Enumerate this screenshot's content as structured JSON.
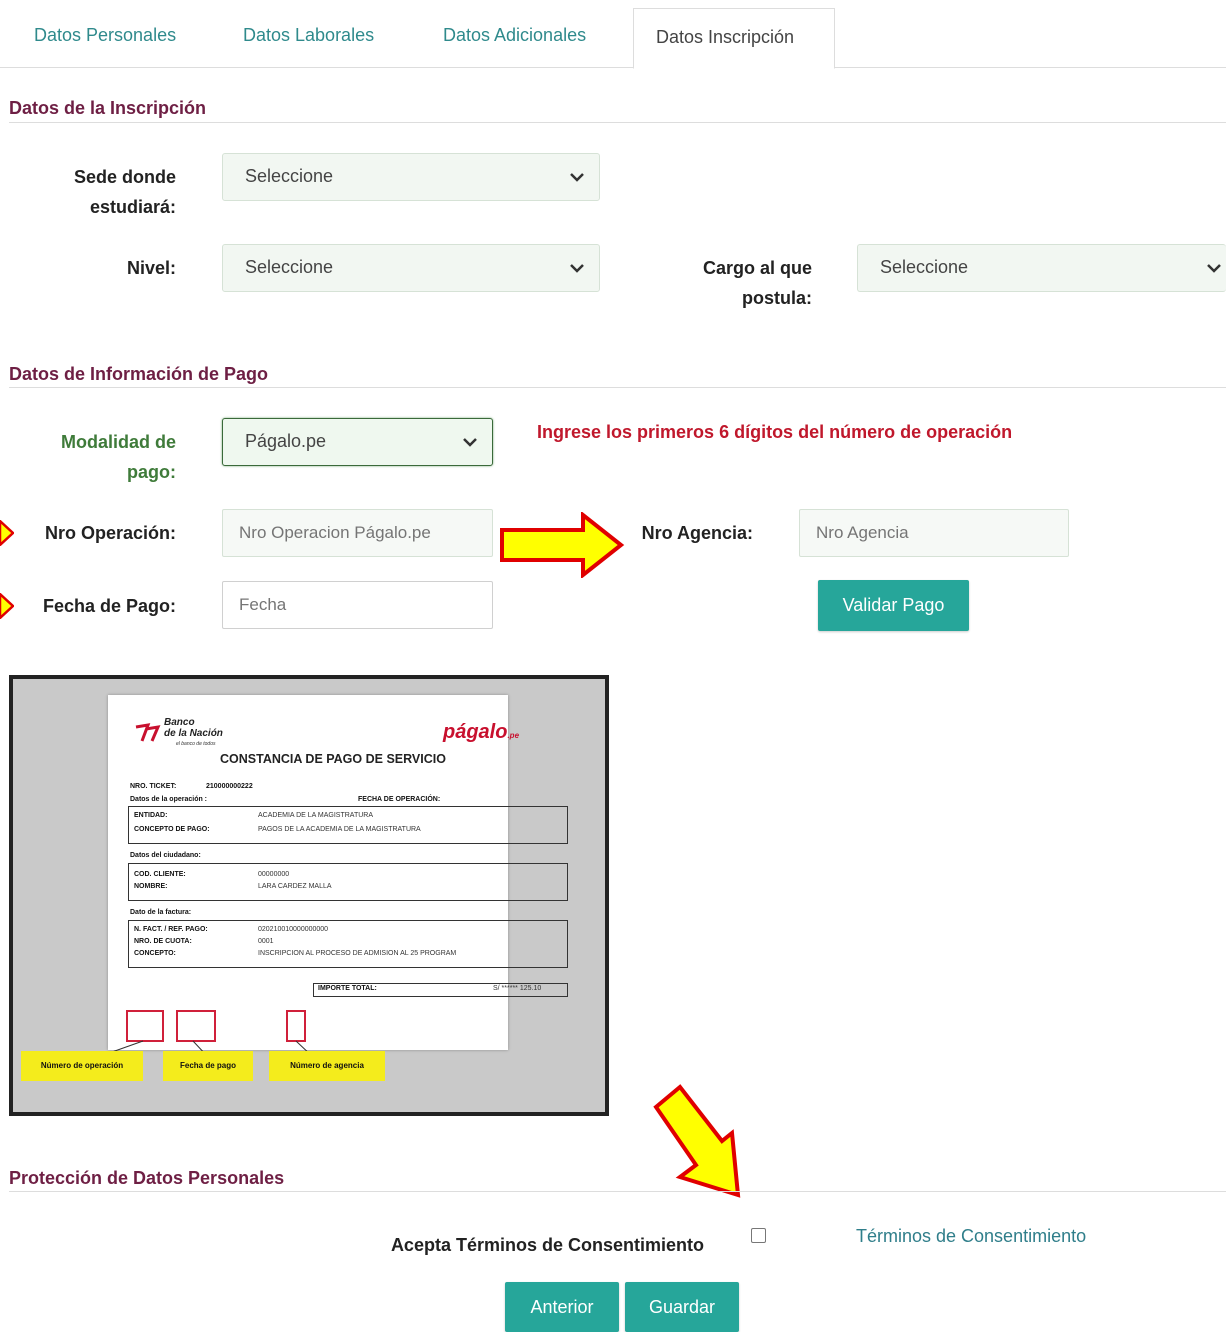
{
  "tabs": [
    {
      "label": "Datos Personales"
    },
    {
      "label": "Datos Laborales"
    },
    {
      "label": "Datos Adicionales"
    },
    {
      "label": "Datos Inscripción",
      "active": true
    }
  ],
  "inscripcion": {
    "title": "Datos de la Inscripción",
    "sede_label": "Sede donde estudiará:",
    "sede_value": "Seleccione",
    "nivel_label": "Nivel:",
    "nivel_value": "Seleccione",
    "cargo_label": "Cargo al que postula:",
    "cargo_value": "Seleccione"
  },
  "pago": {
    "title": "Datos de Información de Pago",
    "modalidad_label": "Modalidad de pago:",
    "modalidad_value": "Págalo.pe",
    "warning": "Ingrese los primeros 6 dígitos del número de operación",
    "operacion_label": "Nro Operación:",
    "operacion_placeholder": "Nro Operacion Págalo.pe",
    "agencia_label": "Nro Agencia:",
    "agencia_placeholder": "Nro Agencia",
    "fecha_label": "Fecha de Pago:",
    "fecha_placeholder": "Fecha",
    "validar_label": "Validar Pago"
  },
  "receipt": {
    "bank_line1": "Banco",
    "bank_line2": "de la Nación",
    "bank_tagline": "el banco de todos",
    "brand": "págalo",
    "brand_suffix": ".pe",
    "title": "CONSTANCIA DE PAGO DE SERVICIO",
    "ticket_label": "NRO. TICKET:",
    "ticket_value": "210000000222",
    "operacion_section": "Datos de la operación :",
    "fecha_op_label": "FECHA DE OPERACIÓN:",
    "entidad_label": "ENTIDAD:",
    "entidad_value": "ACADEMIA DE LA MAGISTRATURA",
    "concepto_label": "CONCEPTO DE PAGO:",
    "concepto_value": "PAGOS DE LA ACADEMIA DE LA MAGISTRATURA",
    "ciudadano_section": "Datos del ciudadano:",
    "cliente_label": "COD. CLIENTE:",
    "cliente_value": "00000000",
    "nombre_label": "NOMBRE:",
    "nombre_value": "LARA CARDEZ MALLA",
    "factura_section": "Dato de la factura:",
    "fact_label": "N. FACT. / REF. PAGO:",
    "fact_value": "020210010000000000",
    "cuota_label": "NRO. DE CUOTA:",
    "cuota_value": "0001",
    "concepto2_label": "CONCEPTO:",
    "concepto2_value": "INSCRIPCION AL PROCESO DE ADMISION AL 25 PROGRAM",
    "importe_label": "IMPORTE TOTAL:",
    "importe_value": "S/ ****** 125.10",
    "callout_operacion": "Número de operación",
    "callout_fecha": "Fecha de pago",
    "callout_agencia": "Número de agencia"
  },
  "proteccion": {
    "title": "Protección de Datos Personales",
    "acepta_label": "Acepta Términos de Consentimiento",
    "terminos_link": "Términos de Consentimiento"
  },
  "actions": {
    "anterior": "Anterior",
    "guardar": "Guardar"
  },
  "colors": {
    "primary_button": "#26a69a",
    "section_title": "#6e1f44",
    "warning": "#c0182c",
    "arrow_fill": "#ffff00",
    "arrow_stroke": "#e00000"
  }
}
